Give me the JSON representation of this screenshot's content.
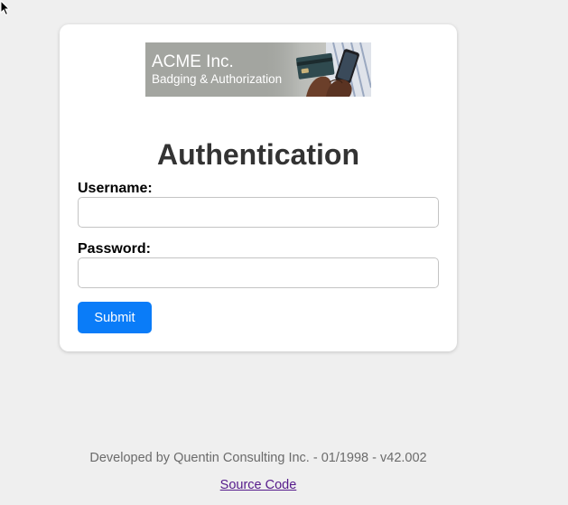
{
  "banner": {
    "company": "ACME Inc.",
    "tagline": "Badging & Authorization"
  },
  "form": {
    "title": "Authentication",
    "username_label": "Username:",
    "username_value": "",
    "password_label": "Password:",
    "password_value": "",
    "submit_label": "Submit"
  },
  "footer": {
    "credit": "Developed by Quentin Consulting Inc. - 01/1998 - v42.002",
    "source_link": "Source Code"
  },
  "colors": {
    "page_background": "#efefef",
    "card_background": "#ffffff",
    "submit_button": "#0a7cf8",
    "visited_link": "#551a8b"
  },
  "icons": {
    "cursor": "mouse-pointer-icon"
  }
}
